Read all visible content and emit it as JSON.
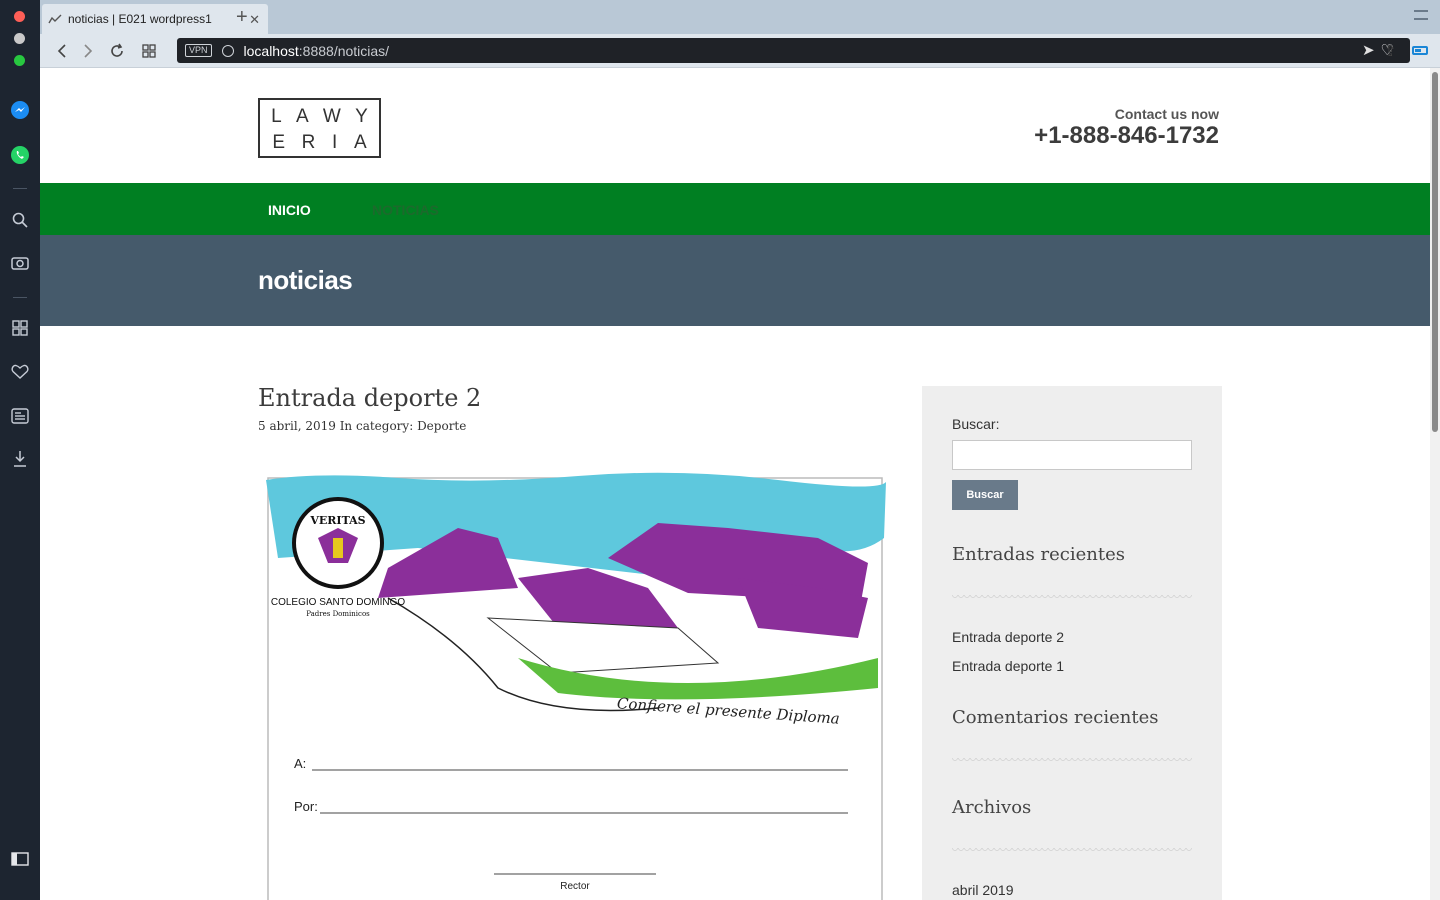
{
  "browser": {
    "tab_title": "noticias | E021 wordpress1",
    "url_host": "localhost",
    "url_rest": ":8888/noticias/",
    "vpn_label": "VPN"
  },
  "header": {
    "logo_row1": [
      "L",
      "A",
      "W",
      "Y"
    ],
    "logo_row2": [
      "E",
      "R",
      "I",
      "A"
    ],
    "contact_label": "Contact us now",
    "phone": "+1-888-846-1732"
  },
  "nav": {
    "items": [
      {
        "label": "INICIO",
        "color": "#ffffff"
      },
      {
        "label": "NOTICIAS",
        "color": "#1c6a2c"
      }
    ]
  },
  "page_title": "noticias",
  "post": {
    "title": "Entrada deporte 2",
    "date": "5 abril, 2019",
    "category_prefix": " In category: ",
    "category": "Deporte"
  },
  "diploma": {
    "school": "COLEGIO SANTO DOMINGO",
    "subtitle": "Padres Dominicos",
    "motto": "VERITAS",
    "script_text": "Confiere el presente Diploma",
    "field_a": "A:",
    "field_por": "Por:",
    "signature": "Rector"
  },
  "sidebar": {
    "search_label": "Buscar:",
    "search_placeholder": "",
    "search_button": "Buscar",
    "recent_posts_title": "Entradas recientes",
    "recent_posts": [
      "Entrada deporte 2",
      "Entrada deporte 1"
    ],
    "recent_comments_title": "Comentarios recientes",
    "archives_title": "Archivos",
    "archives": [
      "abril 2019"
    ]
  },
  "colors": {
    "nav_green": "#007f22",
    "band_slate": "#455a6b",
    "sidebar_bg": "#eeeeee",
    "button": "#697a8a"
  }
}
